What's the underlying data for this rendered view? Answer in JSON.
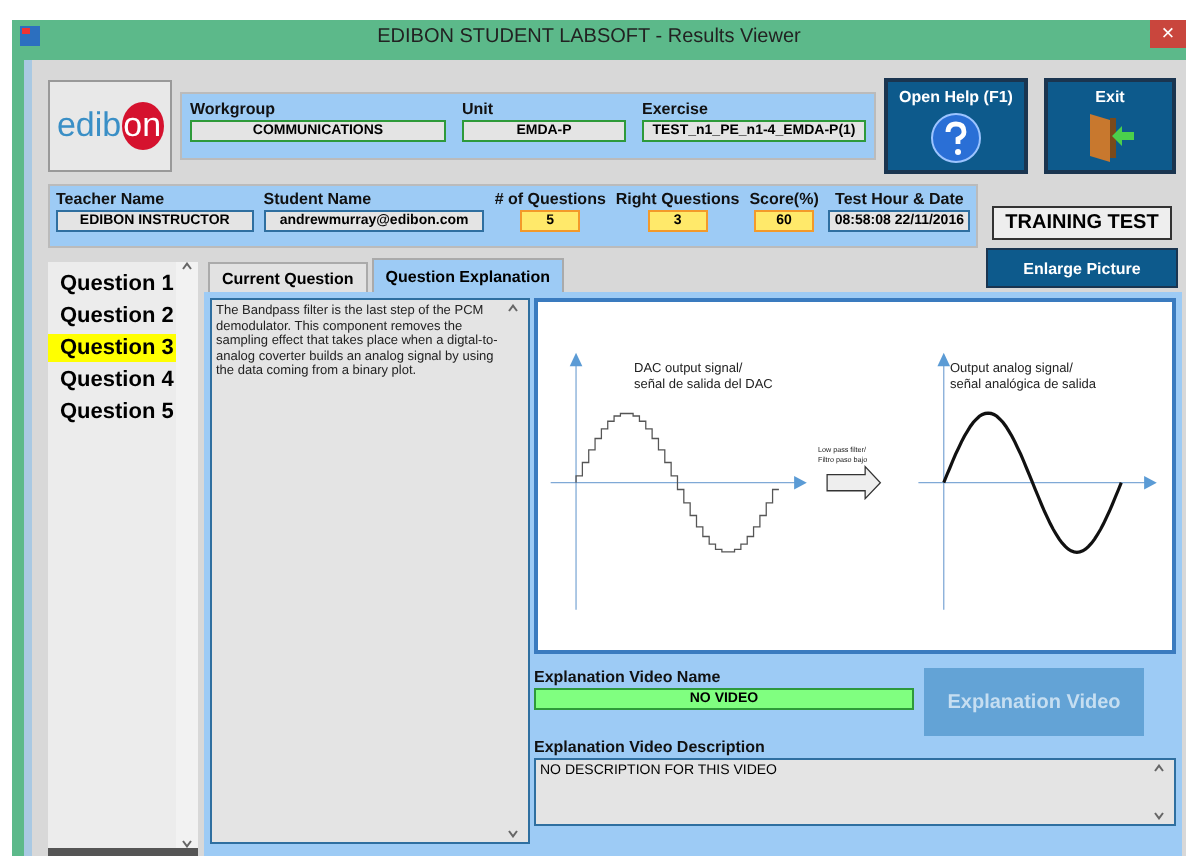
{
  "window": {
    "title": "EDIBON STUDENT LABSOFT - Results Viewer",
    "close": "×"
  },
  "logo": {
    "text_left": "edib",
    "text_right": "on"
  },
  "header": {
    "fields": [
      {
        "label": "Workgroup",
        "value": "COMMUNICATIONS"
      },
      {
        "label": "Unit",
        "value": "EMDA-P"
      },
      {
        "label": "Exercise",
        "value": "TEST_n1_PE_n1-4_EMDA-P(1)"
      }
    ]
  },
  "buttons": {
    "help": "Open Help (F1)",
    "exit": "Exit",
    "training": "TRAINING TEST",
    "enlarge": "Enlarge Picture",
    "video": "Explanation Video"
  },
  "info": [
    {
      "label": "Teacher Name",
      "value": "EDIBON INSTRUCTOR",
      "kind": "text"
    },
    {
      "label": "Student Name",
      "value": "andrewmurray@edibon.com",
      "kind": "text"
    },
    {
      "label": "# of Questions",
      "value": "5",
      "kind": "number"
    },
    {
      "label": "Right Questions",
      "value": "3",
      "kind": "number"
    },
    {
      "label": "Score(%)",
      "value": "60",
      "kind": "number"
    },
    {
      "label": "Test Hour & Date",
      "value": "08:58:08 22/11/2016",
      "kind": "text"
    }
  ],
  "questions": [
    {
      "label": "Question 1",
      "selected": false
    },
    {
      "label": "Question 2",
      "selected": false
    },
    {
      "label": "Question 3",
      "selected": true
    },
    {
      "label": "Question 4",
      "selected": false
    },
    {
      "label": "Question 5",
      "selected": false
    }
  ],
  "tabs": [
    {
      "label": "Current Question",
      "selected": false
    },
    {
      "label": "Question Explanation",
      "selected": true
    }
  ],
  "explanation": "The Bandpass filter is the last step of the PCM demodulator. This component removes the sampling effect that takes place when a digtal-to-analog coverter builds an analog signal by using the data coming from a binary plot.",
  "diagram": {
    "left_label": [
      "DAC output signal/",
      "señal de salida del DAC"
    ],
    "arrow_label": [
      "Low pass filter/",
      "Filtro paso bajo"
    ],
    "right_label": [
      "Output analog signal/",
      "señal analógica de salida"
    ]
  },
  "video": {
    "name_label": "Explanation Video Name",
    "name": "NO VIDEO",
    "description_label": "Explanation Video Description",
    "description": "NO DESCRIPTION FOR THIS VIDEO"
  }
}
